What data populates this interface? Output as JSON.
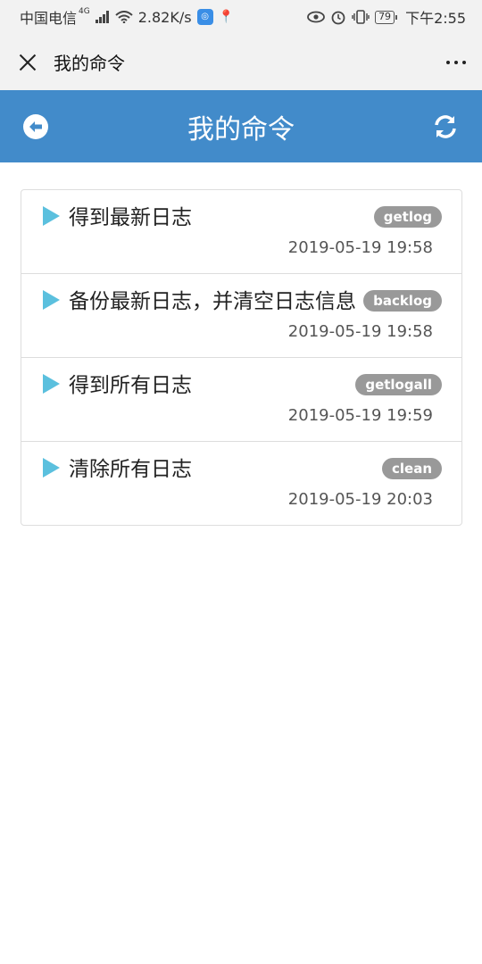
{
  "status_bar": {
    "carrier": "中国电信",
    "network": "4G",
    "speed": "2.82K/s",
    "battery": "79",
    "time": "下午2:55"
  },
  "title_bar": {
    "title": "我的命令"
  },
  "app_header": {
    "title": "我的命令"
  },
  "commands": [
    {
      "title": "得到最新日志",
      "tag": "getlog",
      "time": "2019-05-19 19:58"
    },
    {
      "title": "备份最新日志，并清空日志信息",
      "tag": "backlog",
      "time": "2019-05-19 19:58"
    },
    {
      "title": "得到所有日志",
      "tag": "getlogall",
      "time": "2019-05-19 19:59"
    },
    {
      "title": "清除所有日志",
      "tag": "clean",
      "time": "2019-05-19 20:03"
    }
  ],
  "colors": {
    "header_blue": "#428bca",
    "triangle": "#5bc0de",
    "badge_gray": "#999999"
  }
}
